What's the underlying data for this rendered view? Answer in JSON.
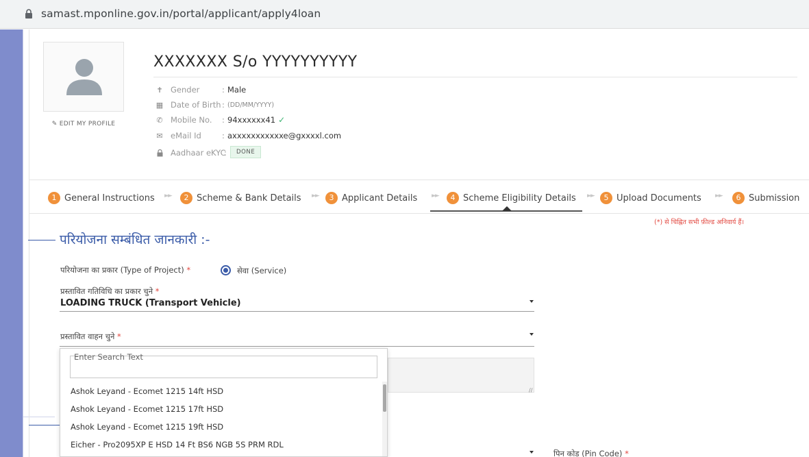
{
  "browser": {
    "url": "samast.mponline.gov.in/portal/applicant/apply4loan",
    "lock_icon": "lock-icon"
  },
  "profile": {
    "name": "XXXXXXX S/o YYYYYYYYYY",
    "edit_label": "EDIT MY PROFILE",
    "fields": {
      "gender": {
        "label": "Gender",
        "value": "Male"
      },
      "dob": {
        "label": "Date of Birth",
        "value": "(DD/MM/YYYY)"
      },
      "mobile": {
        "label": "Mobile No.",
        "value": "94xxxxxx41"
      },
      "email": {
        "label": "eMail Id",
        "value": "axxxxxxxxxxxe@gxxxxl.com"
      },
      "aadhaar": {
        "label": "Aadhaar eKYC",
        "value": "DONE"
      }
    }
  },
  "steps": [
    {
      "num": "1",
      "label": "General Instructions"
    },
    {
      "num": "2",
      "label": "Scheme & Bank Details"
    },
    {
      "num": "3",
      "label": "Applicant Details"
    },
    {
      "num": "4",
      "label": "Scheme Eligibility Details"
    },
    {
      "num": "5",
      "label": "Upload Documents"
    },
    {
      "num": "6",
      "label": "Submission"
    }
  ],
  "active_step": 4,
  "mandatory_note": "(*) से चिह्नित सभी फ़ील्ड अनिवार्य हैं।",
  "section": {
    "title": "परियोजना सम्बंधित जानकारी :-"
  },
  "form": {
    "project_type_label": "परियोजना का प्रकार (Type of Project)",
    "project_type_option": "सेवा (Service)",
    "activity_label": "प्रस्तावित गतिविधि का प्रकार चुने",
    "activity_value": "LOADING TRUCK (Transport Vehicle)",
    "vehicle_label": "प्रस्तावित वाहन चुने",
    "required_mark": "*",
    "pin_label": "पिन कोड (Pin Code)"
  },
  "dropdown": {
    "search_placeholder": "Enter Search Text",
    "items": [
      "Ashok Leyand - Ecomet 1215 14ft HSD",
      "Ashok Leyand - Ecomet 1215 17ft HSD",
      "Ashok Leyand - Ecomet 1215 19ft HSD",
      "Eicher - Pro2095XP E HSD 14 Ft BS6 NGB 5S PRM RDL"
    ]
  },
  "colors": {
    "accent": "#3a5ba8",
    "step_badge": "#f0913a",
    "required": "#e2473f",
    "sidebar": "#7f8ccc"
  }
}
